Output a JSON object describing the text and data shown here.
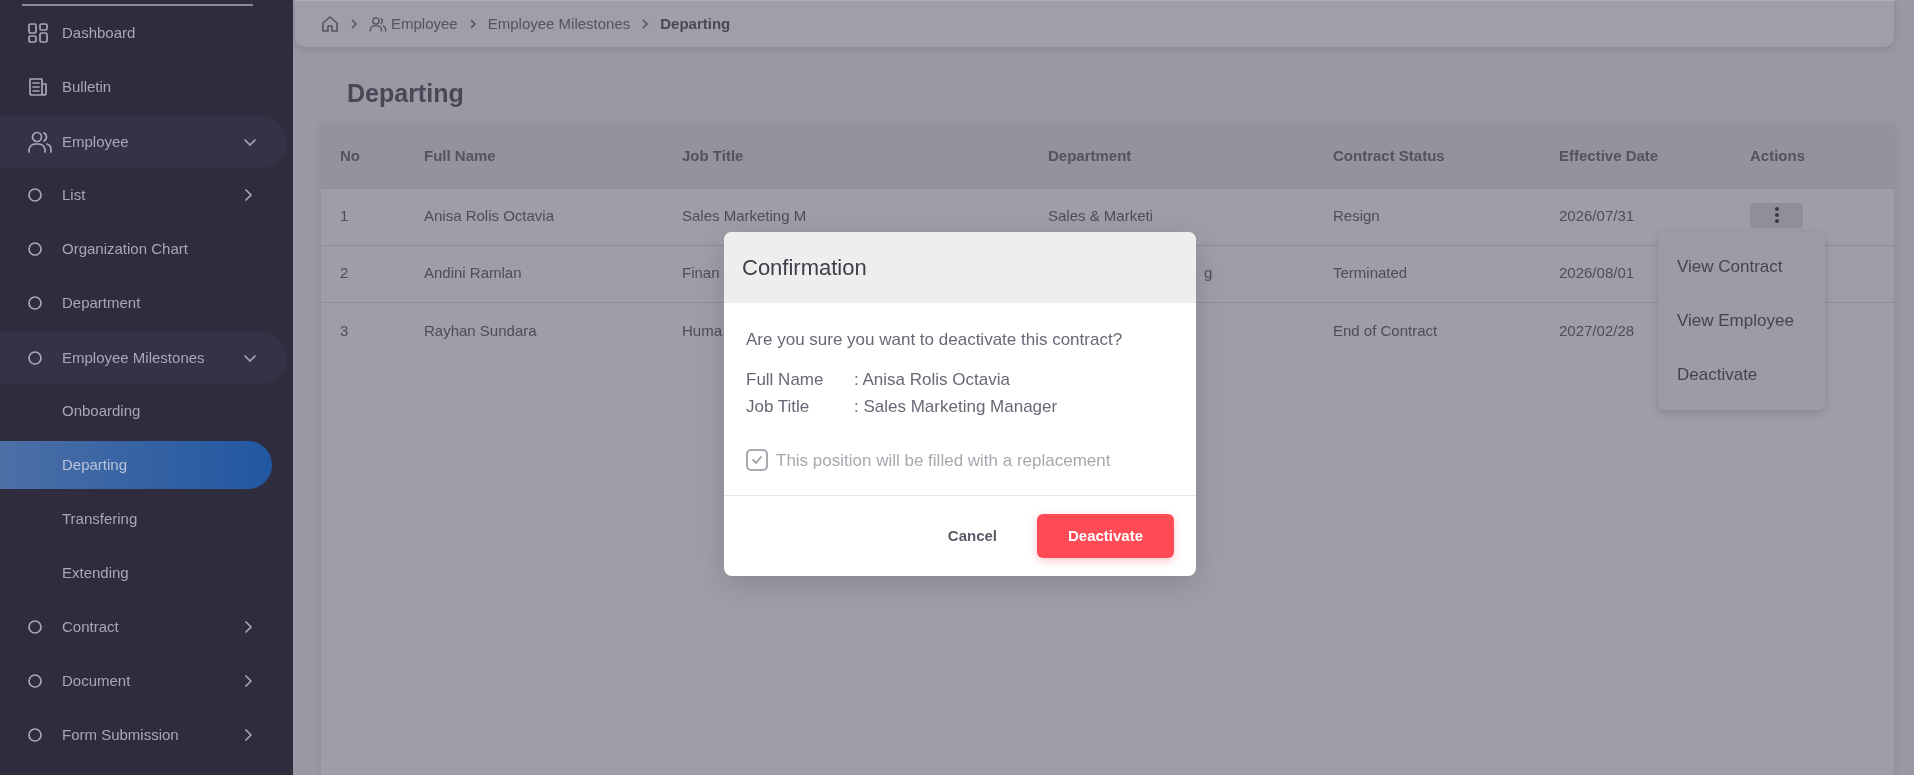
{
  "sidebar": {
    "items": [
      {
        "label": "Dashboard",
        "selected": false
      },
      {
        "label": "Bulletin",
        "selected": false
      },
      {
        "label": "Employee",
        "selected": false,
        "expanded": true,
        "children": [
          {
            "label": "List",
            "selected": false,
            "expanded": false
          },
          {
            "label": "Organization Chart",
            "selected": false
          },
          {
            "label": "Department",
            "selected": false
          },
          {
            "label": "Employee Milestones",
            "selected": false,
            "expanded": true,
            "children": [
              {
                "label": "Onboarding",
                "selected": false
              },
              {
                "label": "Departing",
                "selected": true
              },
              {
                "label": "Transfering",
                "selected": false
              },
              {
                "label": "Extending",
                "selected": false
              }
            ]
          },
          {
            "label": "Contract",
            "selected": false,
            "expanded": false
          },
          {
            "label": "Document",
            "selected": false,
            "expanded": false
          },
          {
            "label": "Form Submission",
            "selected": false,
            "expanded": false
          }
        ]
      }
    ]
  },
  "breadcrumb": [
    {
      "label": "Employee",
      "current": false
    },
    {
      "label": "Employee Milestones",
      "current": false
    },
    {
      "label": "Departing",
      "current": true
    }
  ],
  "page_title": "Departing",
  "table": {
    "columns": [
      "No",
      "Full Name",
      "Job Title",
      "Department",
      "Contract Status",
      "Effective Date",
      "Actions"
    ],
    "rows": [
      {
        "no": "1",
        "full_name": "Anisa Rolis Octavia",
        "job_title": "Sales Marketing M",
        "department": "Sales & Marketi",
        "contract_status": "Resign",
        "effective_date": "2026/07/31",
        "menu_open": true
      },
      {
        "no": "2",
        "full_name": "Andini Ramlan",
        "job_title": "Finan",
        "department": "g",
        "department_cut_start": true,
        "contract_status": "Terminated",
        "effective_date": "2026/08/01",
        "menu_open": false
      },
      {
        "no": "3",
        "full_name": "Rayhan Sundara",
        "job_title": "Huma",
        "contract_status": "End of Contract",
        "effective_date": "2027/02/28",
        "menu_open": false
      }
    ],
    "action_menu": [
      "View Contract",
      "View Employee",
      "Deactivate"
    ]
  },
  "modal": {
    "title": "Confirmation",
    "message": "Are you sure you want to deactivate this contract?",
    "fields": [
      {
        "label": "Full Name",
        "value": ": Anisa Rolis Octavia"
      },
      {
        "label": "Job Title",
        "value": ": Sales Marketing Manager"
      }
    ],
    "checkbox": {
      "label": "This position will be filled with a replacement",
      "checked": true,
      "disabled": true
    },
    "buttons": [
      {
        "label": "Cancel",
        "kind": "cancel"
      },
      {
        "label": "Deactivate",
        "kind": "danger"
      }
    ]
  }
}
